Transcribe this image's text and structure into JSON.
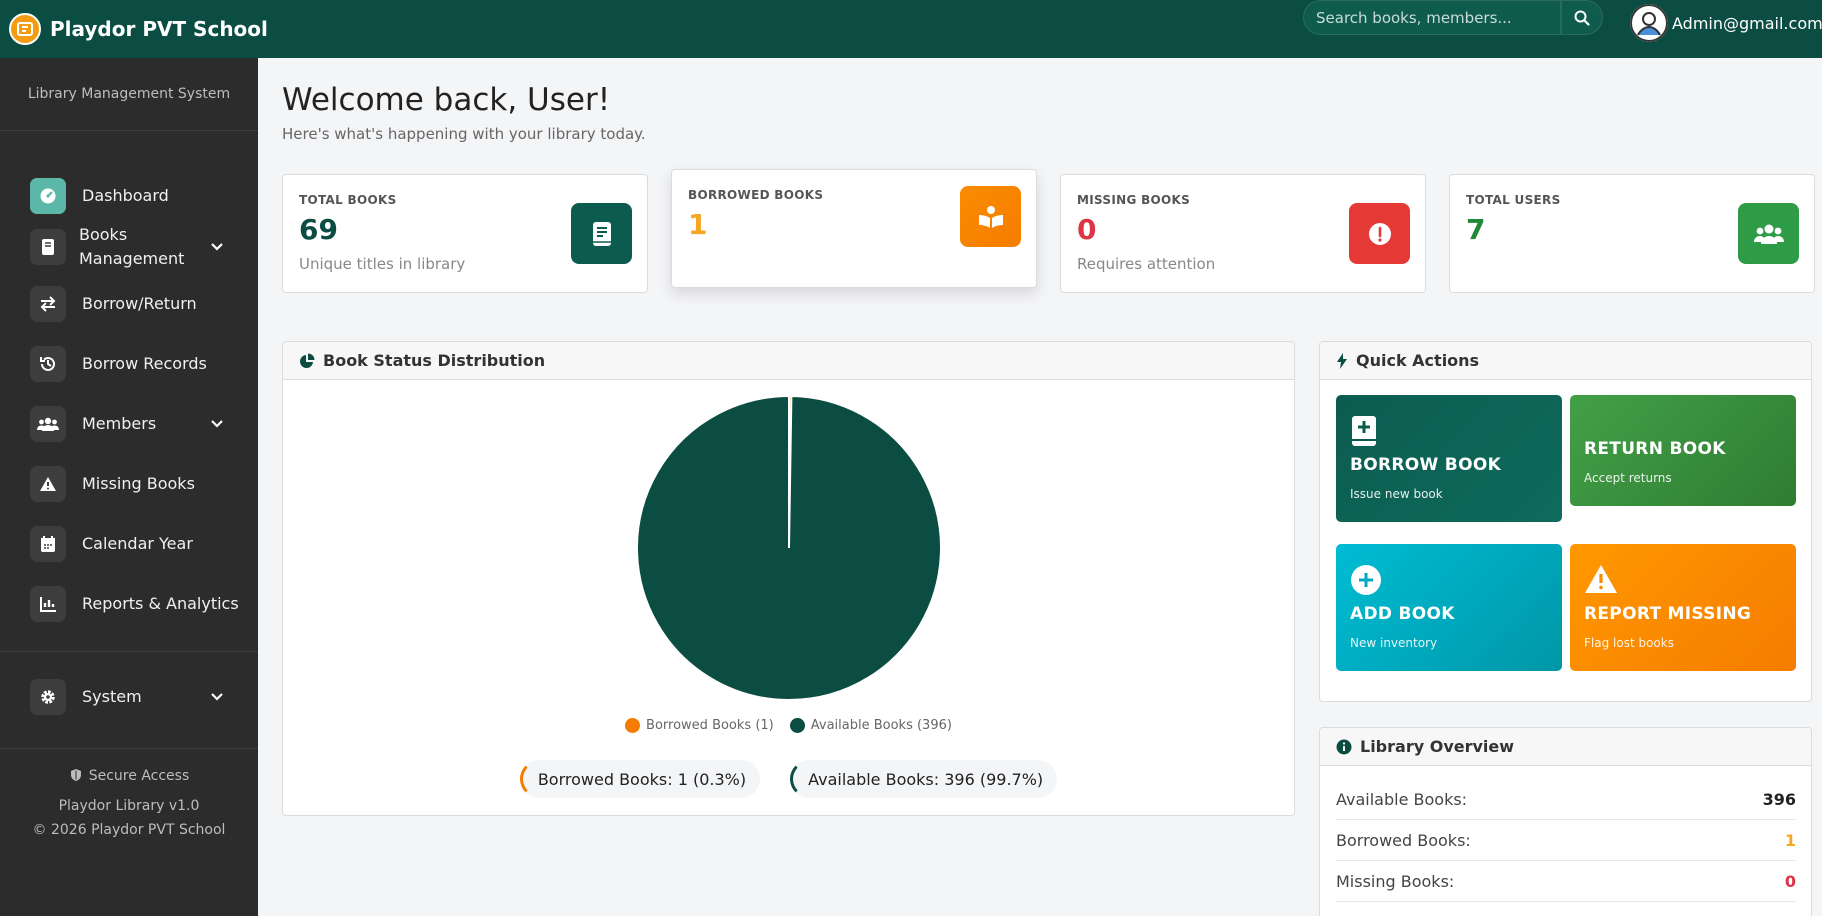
{
  "topbar": {
    "brand_name": "Playdor PVT School",
    "search_placeholder": "Search books, members...",
    "user_email": "Admin@gmail.com"
  },
  "sidebar": {
    "title": "Library Management System",
    "items": [
      {
        "label": "Dashboard",
        "icon": "gauge-icon",
        "active": true
      },
      {
        "label": "Books Management",
        "icon": "book-icon",
        "expandable": true
      },
      {
        "label": "Borrow/Return",
        "icon": "exchange-icon"
      },
      {
        "label": "Borrow Records",
        "icon": "history-icon"
      },
      {
        "label": "Members",
        "icon": "users-icon",
        "expandable": true
      },
      {
        "label": "Missing Books",
        "icon": "warning-icon"
      },
      {
        "label": "Calendar Year",
        "icon": "calendar-icon"
      },
      {
        "label": "Reports & Analytics",
        "icon": "chart-icon"
      },
      {
        "label": "System",
        "icon": "gear-icon",
        "expandable": true
      }
    ],
    "footer": {
      "secure": "Secure Access",
      "version": "Playdor Library v1.0",
      "copyright": "© 2026 Playdor PVT School"
    }
  },
  "main": {
    "welcome": "Welcome back, User!",
    "subwelcome": "Here's what's happening with your library today."
  },
  "stats": [
    {
      "label": "TOTAL BOOKS",
      "value": "69",
      "desc": "Unique titles in library",
      "color": "#0b4d42",
      "icon": "book-icon"
    },
    {
      "label": "BORROWED BOOKS",
      "value": "1",
      "desc": "",
      "color": "#f5a623",
      "icon": "open-book-icon"
    },
    {
      "label": "MISSING BOOKS",
      "value": "0",
      "desc": "Requires attention",
      "color": "#dc3545",
      "icon": "alert-icon"
    },
    {
      "label": "TOTAL USERS",
      "value": "7",
      "desc": "",
      "color": "#218838",
      "icon": "users-icon"
    }
  ],
  "chart_panel": {
    "title": "Book Status Distribution",
    "summary_borrowed": "Borrowed Books: 1 (0.3%)",
    "summary_available": "Available Books: 396 (99.7%)"
  },
  "chart_data": {
    "type": "pie",
    "categories": [
      "Borrowed Books (1)",
      "Available Books (396)"
    ],
    "values": [
      1,
      396
    ],
    "colors": [
      "#f57c00",
      "#0b4d42"
    ],
    "legend": "bottom"
  },
  "quick_actions": {
    "title": "Quick Actions",
    "cards": [
      {
        "title": "BORROW BOOK",
        "sub": "Issue new book",
        "icon": "book-plus-icon"
      },
      {
        "title": "RETURN BOOK",
        "sub": "Accept returns",
        "icon": ""
      },
      {
        "title": "ADD BOOK",
        "sub": "New inventory",
        "icon": "plus-circle-icon"
      },
      {
        "title": "REPORT MISSING",
        "sub": "Flag lost books",
        "icon": "warning-icon"
      }
    ]
  },
  "overview": {
    "title": "Library Overview",
    "rows": [
      {
        "label": "Available Books:",
        "value": "396",
        "color": "#222222"
      },
      {
        "label": "Borrowed Books:",
        "value": "1",
        "color": "#f5a623"
      },
      {
        "label": "Missing Books:",
        "value": "0",
        "color": "#dc3545"
      }
    ]
  }
}
